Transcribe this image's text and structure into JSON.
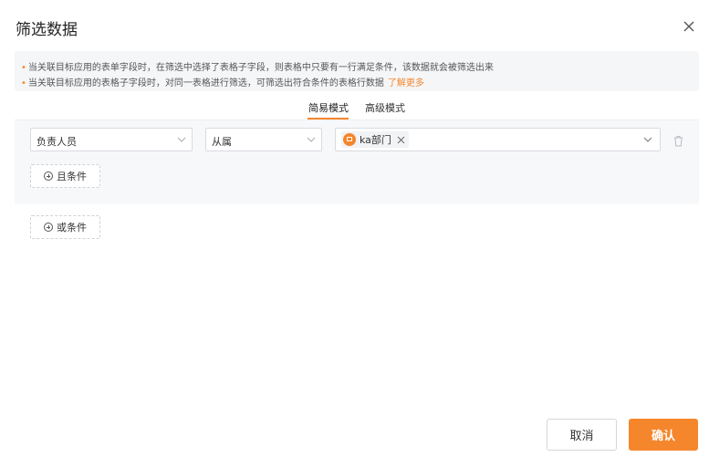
{
  "dialog": {
    "title": "筛选数据"
  },
  "notice": {
    "line1": "当关联目标应用的表单字段时，在筛选中选择了表格子字段，则表格中只要有一行满足条件，该数据就会被筛选出来",
    "line2": "当关联目标应用的表格子字段时，对同一表格进行筛选，可筛选出符合条件的表格行数据",
    "learn_more": "了解更多",
    "accent_color": "#f5862c"
  },
  "tabs": [
    {
      "label": "简易模式",
      "active": true
    },
    {
      "label": "高级模式",
      "active": false
    }
  ],
  "condition": {
    "field": "负责人员",
    "operator": "从属",
    "value_tag": "ka部门"
  },
  "buttons": {
    "and_condition": "且条件",
    "or_condition": "或条件",
    "cancel": "取消",
    "confirm": "确认"
  },
  "icons": [
    "close-icon",
    "chevron-down-icon",
    "department-icon",
    "remove-tag-icon",
    "trash-icon",
    "plus-circle-icon"
  ]
}
